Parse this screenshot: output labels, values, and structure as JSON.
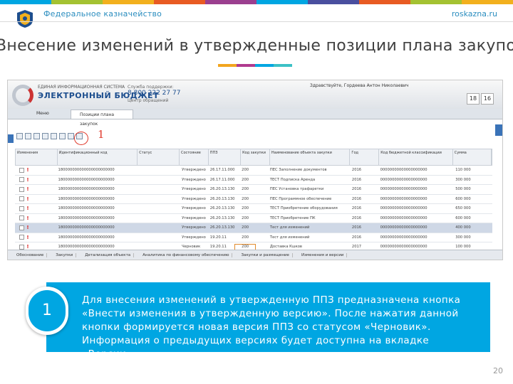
{
  "header": {
    "org_name": "Федеральное казначейство",
    "site": "roskazna.ru",
    "stripe_colors": [
      "#00a6e2",
      "#a4c232",
      "#f2b01e",
      "#e85b23",
      "#9b3f8f",
      "#00a6e2",
      "#4a4f9f",
      "#e85b23",
      "#a4c232",
      "#f2b01e"
    ]
  },
  "slide": {
    "title": "Внесение изменений в утвержденные позиции плана закупок",
    "deco_colors": [
      "#f2a51e",
      "#b03a8e",
      "#00a6e2",
      "#3cc1c6"
    ],
    "page_number": "20"
  },
  "screenshot": {
    "logo_line1": "ЭЛЕКТРОННЫЙ БЮДЖЕТ",
    "logo_caption": "ЕДИНАЯ ИНФОРМАЦИОННАЯ СИСТЕМА",
    "phone_caption": "Служба поддержки:",
    "phone": "8 800 222 27 77",
    "phone_note": "Центр обращений",
    "user": "Здравствуйте, Гордеева Антон Николаевич",
    "date_box_1": "18",
    "date_box_2": "16",
    "menu_item": "Меню",
    "tab_label": "Позиции плана закупок",
    "marker_number": "1",
    "table": {
      "columns": [
        "Изменения",
        "Идентификационный код",
        "Статус",
        "Состояние",
        "ППЗ",
        "Код закупки",
        "Наименование объекта закупки",
        "Год",
        "Код бюджетной классификации",
        "Сумма"
      ],
      "rows": [
        {
          "code": "180000000000000000000000",
          "status": "Утверждено",
          "ppz": "26.17.11.000",
          "kod": "200",
          "name": "ПЕС Заполнение документов",
          "year": "2016",
          "kbk": "00000000000000000000",
          "sum": "110 000"
        },
        {
          "code": "180000000000000000000000",
          "status": "Утверждено",
          "ppz": "26.17.11.000",
          "kod": "200",
          "name": "ТЕСТ Подписка Аренда",
          "year": "2016",
          "kbk": "00000000000000000000",
          "sum": "300 000"
        },
        {
          "code": "180000000000000000000000",
          "status": "Утверждено",
          "ppz": "26.20.13.130",
          "kod": "200",
          "name": "ПЕС Установка трафаретки",
          "year": "2016",
          "kbk": "00000000000000000000",
          "sum": "500 000"
        },
        {
          "code": "180000000000000000000000",
          "status": "Утверждено",
          "ppz": "26.20.13.130",
          "kod": "200",
          "name": "ПЕС Программное обеспечение",
          "year": "2016",
          "kbk": "00000000000000000000",
          "sum": "600 000"
        },
        {
          "code": "180000000000000000000000",
          "status": "Утверждено",
          "ppz": "26.20.13.130",
          "kod": "200",
          "name": "ТЕСТ Приобретение оборудования",
          "year": "2016",
          "kbk": "00000000000000000000",
          "sum": "650 000"
        },
        {
          "code": "180000000000000000000000",
          "status": "Утверждено",
          "ppz": "26.20.13.130",
          "kod": "200",
          "name": "ТЕСТ Приобретение ПК",
          "year": "2016",
          "kbk": "00000000000000000000",
          "sum": "600 000"
        },
        {
          "code": "180000000000000000000000",
          "status": "Утверждено",
          "ppz": "26.20.13.130",
          "kod": "200",
          "name": "Тест для изменений",
          "year": "2016",
          "kbk": "00000000000000000000",
          "sum": "400 000"
        },
        {
          "code": "180000000000000000000000",
          "status": "Утверждено",
          "ppz": "19.20.11",
          "kod": "200",
          "name": "Тест для изменений",
          "year": "2016",
          "kbk": "00000000000000000000",
          "sum": "300 000"
        },
        {
          "code": "180000000000000000000000",
          "status": "Черновик",
          "ppz": "19.20.11",
          "kod": "200",
          "name": "Доставка Кшков",
          "year": "2017",
          "kbk": "00000000000000000000",
          "sum": "100 000"
        },
        {
          "code": "180000000000000000000000",
          "status": "Черновик",
          "ppz": "19.20.11",
          "kod": "200",
          "name": "Доставка",
          "year": "2017",
          "kbk": "00000000000000000000",
          "sum": "500 000"
        }
      ]
    },
    "bottom_tabs": [
      "Обоснование",
      "Закупки",
      "Детализация объекта",
      "Аналитика по финансовому обеспечению",
      "Закупки и размещение",
      "Изменения и версии"
    ]
  },
  "callout": {
    "badge": "1",
    "text": "Для внесения изменений в утвержденную ППЗ предназначена кнопка «Внести изменения в утвержденную версию». После нажатия данной кнопки формируется новая версия ППЗ со статусом «Черновик». Информация о предыдущих версиях будет доступна на вкладке «Версии»."
  }
}
